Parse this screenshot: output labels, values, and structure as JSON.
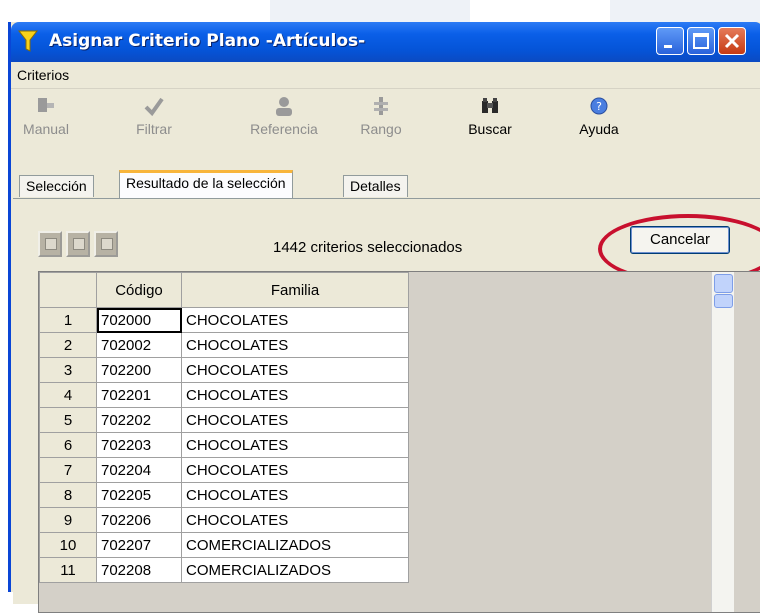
{
  "window": {
    "title": "Asignar Criterio Plano -Artículos-"
  },
  "menu": {
    "items": [
      "Criterios"
    ]
  },
  "toolbar": {
    "manual": "Manual",
    "filtrar": "Filtrar",
    "referencia": "Referencia",
    "rango": "Rango",
    "buscar": "Buscar",
    "ayuda": "Ayuda"
  },
  "tabs": [
    "Selección",
    "Resultado de la selección",
    "Detalles"
  ],
  "panel": {
    "count_text": "1442 criterios seleccionados",
    "cancel_label": "Cancelar"
  },
  "grid": {
    "headers": [
      "Código",
      "Familia"
    ],
    "rows": [
      {
        "n": "1",
        "codigo": "702000",
        "familia": "CHOCOLATES"
      },
      {
        "n": "2",
        "codigo": "702002",
        "familia": "CHOCOLATES"
      },
      {
        "n": "3",
        "codigo": "702200",
        "familia": "CHOCOLATES"
      },
      {
        "n": "4",
        "codigo": "702201",
        "familia": "CHOCOLATES"
      },
      {
        "n": "5",
        "codigo": "702202",
        "familia": "CHOCOLATES"
      },
      {
        "n": "6",
        "codigo": "702203",
        "familia": "CHOCOLATES"
      },
      {
        "n": "7",
        "codigo": "702204",
        "familia": "CHOCOLATES"
      },
      {
        "n": "8",
        "codigo": "702205",
        "familia": "CHOCOLATES"
      },
      {
        "n": "9",
        "codigo": "702206",
        "familia": "CHOCOLATES"
      },
      {
        "n": "10",
        "codigo": "702207",
        "familia": "COMERCIALIZADOS"
      },
      {
        "n": "11",
        "codigo": "702208",
        "familia": "COMERCIALIZADOS"
      }
    ]
  },
  "colors": {
    "titlebar": "#0554d8",
    "highlight_ellipse": "#c8102e",
    "active_tab_accent": "#f8b53b"
  }
}
